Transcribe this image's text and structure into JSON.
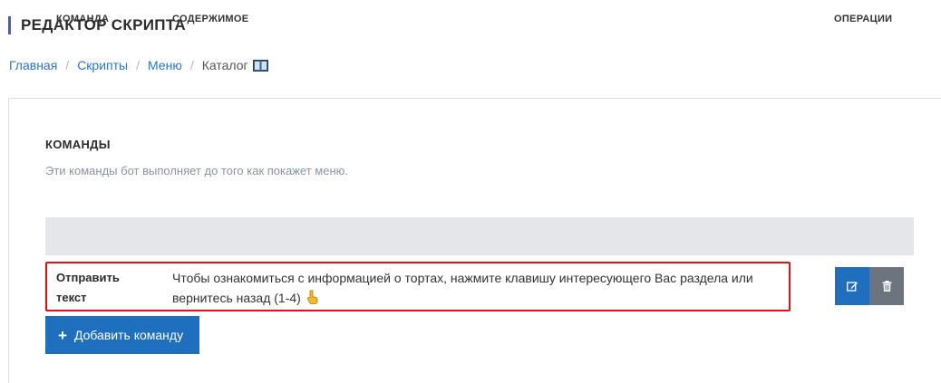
{
  "page": {
    "title": "РЕДАКТОР СКРИПТА"
  },
  "breadcrumb": {
    "items": [
      "Главная",
      "Скрипты",
      "Меню"
    ],
    "current": "Каталог",
    "current_icon": "book-icon"
  },
  "section": {
    "title": "КОМАНДЫ",
    "description": "Эти команды бот выполняет до того как покажет меню."
  },
  "table": {
    "headers": {
      "command": "КОМАНДА",
      "content": "СОДЕРЖИМОЕ",
      "operations": "ОПЕРАЦИИ"
    },
    "rows": [
      {
        "command": "Отправить текст",
        "content": "Чтобы ознакомиться с информацией о тортах, нажмите клавишу интересующего Вас раздела или вернитесь назад (1-4)",
        "content_icon": "pointing-hand-icon",
        "highlighted": true
      }
    ]
  },
  "actions": {
    "add_command_label": "Добавить команду"
  },
  "colors": {
    "accent": "#1f6fbf",
    "header_bar": "#4a5bc4",
    "highlight": "#e20f14",
    "delete": "#6c757d",
    "link": "#2a76c6"
  }
}
